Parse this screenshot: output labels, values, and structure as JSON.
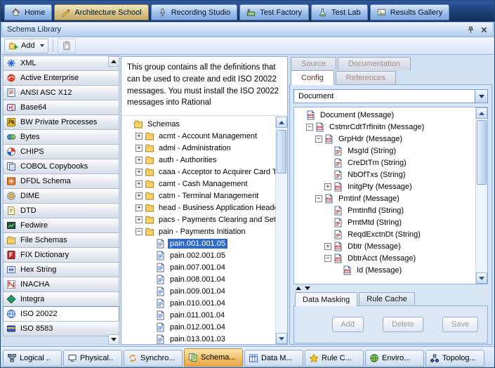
{
  "top_bar": {
    "tabs": [
      {
        "label": "Home",
        "icon": "home",
        "selected": false
      },
      {
        "label": "Architecture School",
        "icon": "arch",
        "selected": true
      },
      {
        "label": "Recording Studio",
        "icon": "mic",
        "selected": false
      },
      {
        "label": "Test Factory",
        "icon": "factory",
        "selected": false
      },
      {
        "label": "Test Lab",
        "icon": "flask",
        "selected": false
      },
      {
        "label": "Results Gallery",
        "icon": "gallery",
        "selected": false
      }
    ]
  },
  "window": {
    "title": "Schema Library"
  },
  "toolbar": {
    "add_label": "Add"
  },
  "sidebar": {
    "items": [
      {
        "label": "XML",
        "icon": "xml"
      },
      {
        "label": "Active Enterprise",
        "icon": "active-enterprise"
      },
      {
        "label": "ANSI ASC X12",
        "icon": "ansi"
      },
      {
        "label": "Base64",
        "icon": "base64"
      },
      {
        "label": "BW Private Processes",
        "icon": "bw"
      },
      {
        "label": "Bytes",
        "icon": "bytes"
      },
      {
        "label": "CHIPS",
        "icon": "chips"
      },
      {
        "label": "COBOL Copybooks",
        "icon": "cobol"
      },
      {
        "label": "DFDL Schema",
        "icon": "dfdl"
      },
      {
        "label": "DIME",
        "icon": "dime"
      },
      {
        "label": "DTD",
        "icon": "dtd"
      },
      {
        "label": "Fedwire",
        "icon": "fedwire"
      },
      {
        "label": "File Schemas",
        "icon": "folder"
      },
      {
        "label": "FIX Dictionary",
        "icon": "fix"
      },
      {
        "label": "Hex String",
        "icon": "hex"
      },
      {
        "label": "INACHA",
        "icon": "inacha"
      },
      {
        "label": "Integra",
        "icon": "integra"
      },
      {
        "label": "ISO 20022",
        "icon": "iso20022",
        "selected": true
      },
      {
        "label": "ISO 8583",
        "icon": "iso8583"
      }
    ]
  },
  "description": {
    "text": "This group contains all the definitions that can be used to create and edit ISO 20022 messages. You must install the ISO 20022 messages into Rational"
  },
  "schema_tree": {
    "items": [
      {
        "label": "Schemas",
        "icon": "folder",
        "indent": 0
      },
      {
        "label": "acmt - Account Management",
        "icon": "folder",
        "indent": 1,
        "exp": "+"
      },
      {
        "label": "admi - Administration",
        "icon": "folder",
        "indent": 1,
        "exp": "+"
      },
      {
        "label": "auth - Authorities",
        "icon": "folder",
        "indent": 1,
        "exp": "+"
      },
      {
        "label": "caaa - Acceptor to Acquirer Card Tra",
        "icon": "folder",
        "indent": 1,
        "exp": "+"
      },
      {
        "label": "camt - Cash Management",
        "icon": "folder",
        "indent": 1,
        "exp": "+"
      },
      {
        "label": "catm - Terminal Management",
        "icon": "folder",
        "indent": 1,
        "exp": "+"
      },
      {
        "label": "head - Business Application Header",
        "icon": "folder",
        "indent": 1,
        "exp": "+"
      },
      {
        "label": "pacs - Payments Clearing and Settle",
        "icon": "folder",
        "indent": 1,
        "exp": "+"
      },
      {
        "label": "pain - Payments Initiation",
        "icon": "folder",
        "indent": 1,
        "exp": "−"
      },
      {
        "label": "pain.001.001.05",
        "icon": "schema-doc",
        "indent": 2,
        "selected": true
      },
      {
        "label": "pain.002.001.05",
        "icon": "schema-doc",
        "indent": 2
      },
      {
        "label": "pain.007.001.04",
        "icon": "schema-doc",
        "indent": 2
      },
      {
        "label": "pain.008.001.04",
        "icon": "schema-doc",
        "indent": 2
      },
      {
        "label": "pain.009.001.04",
        "icon": "schema-doc",
        "indent": 2
      },
      {
        "label": "pain.010.001.04",
        "icon": "schema-doc",
        "indent": 2
      },
      {
        "label": "pain.011.001.04",
        "icon": "schema-doc",
        "indent": 2
      },
      {
        "label": "pain.012.001.04",
        "icon": "schema-doc",
        "indent": 2
      },
      {
        "label": "pain.013.001.03",
        "icon": "schema-doc",
        "indent": 2
      }
    ]
  },
  "right_panel": {
    "tabs": {
      "source": "Source",
      "documentation": "Documentation",
      "config": "Config",
      "references": "References"
    },
    "dropdown_value": "Document",
    "tree": {
      "items": [
        {
          "label": "Document (Message)",
          "icon": "msg",
          "indent": 0
        },
        {
          "label": "CstmrCdtTrfInitn (Message)",
          "icon": "msg",
          "indent": 1,
          "exp": "−"
        },
        {
          "label": "GrpHdr (Message)",
          "icon": "msg",
          "indent": 2,
          "exp": "−"
        },
        {
          "label": "MsgId (String)",
          "icon": "str",
          "indent": 3
        },
        {
          "label": "CreDtTm (String)",
          "icon": "str",
          "indent": 3
        },
        {
          "label": "NbOfTxs (String)",
          "icon": "str",
          "indent": 3
        },
        {
          "label": "InitgPty (Message)",
          "icon": "msg",
          "indent": 3,
          "exp": "+"
        },
        {
          "label": "PmtInf (Message)",
          "icon": "msg",
          "indent": 2,
          "exp": "−"
        },
        {
          "label": "PmtInfId (String)",
          "icon": "str",
          "indent": 3
        },
        {
          "label": "PmtMtd (String)",
          "icon": "str",
          "indent": 3
        },
        {
          "label": "ReqdExctnDt (String)",
          "icon": "str",
          "indent": 3
        },
        {
          "label": "Dbtr (Message)",
          "icon": "msg",
          "indent": 3,
          "exp": "+"
        },
        {
          "label": "DbtrAcct (Message)",
          "icon": "msg",
          "indent": 3,
          "exp": "−"
        },
        {
          "label": "Id (Message)",
          "icon": "msg",
          "indent": 4
        }
      ]
    },
    "bottom_tabs": {
      "data_masking": "Data Masking",
      "rule_cache": "Rule Cache"
    },
    "buttons": {
      "add": "Add",
      "delete": "Delete",
      "save": "Save"
    }
  },
  "bottom_bar": {
    "tabs": [
      {
        "label": "Logical ..",
        "icon": "logical"
      },
      {
        "label": "Physical..",
        "icon": "physical"
      },
      {
        "label": "Synchro...",
        "icon": "synchro"
      },
      {
        "label": "Schema...",
        "icon": "schema",
        "selected": true
      },
      {
        "label": "Data M...",
        "icon": "data-model"
      },
      {
        "label": "Rule C...",
        "icon": "rule-cache"
      },
      {
        "label": "Enviro...",
        "icon": "environments"
      },
      {
        "label": "Topolog...",
        "icon": "topology"
      }
    ]
  },
  "colors": {
    "selection_blue": "#316ac5",
    "active_top_tab": "#d9c488",
    "active_bottom_tab": "#f0bc62",
    "disabled_text": "#9a9a9a"
  }
}
